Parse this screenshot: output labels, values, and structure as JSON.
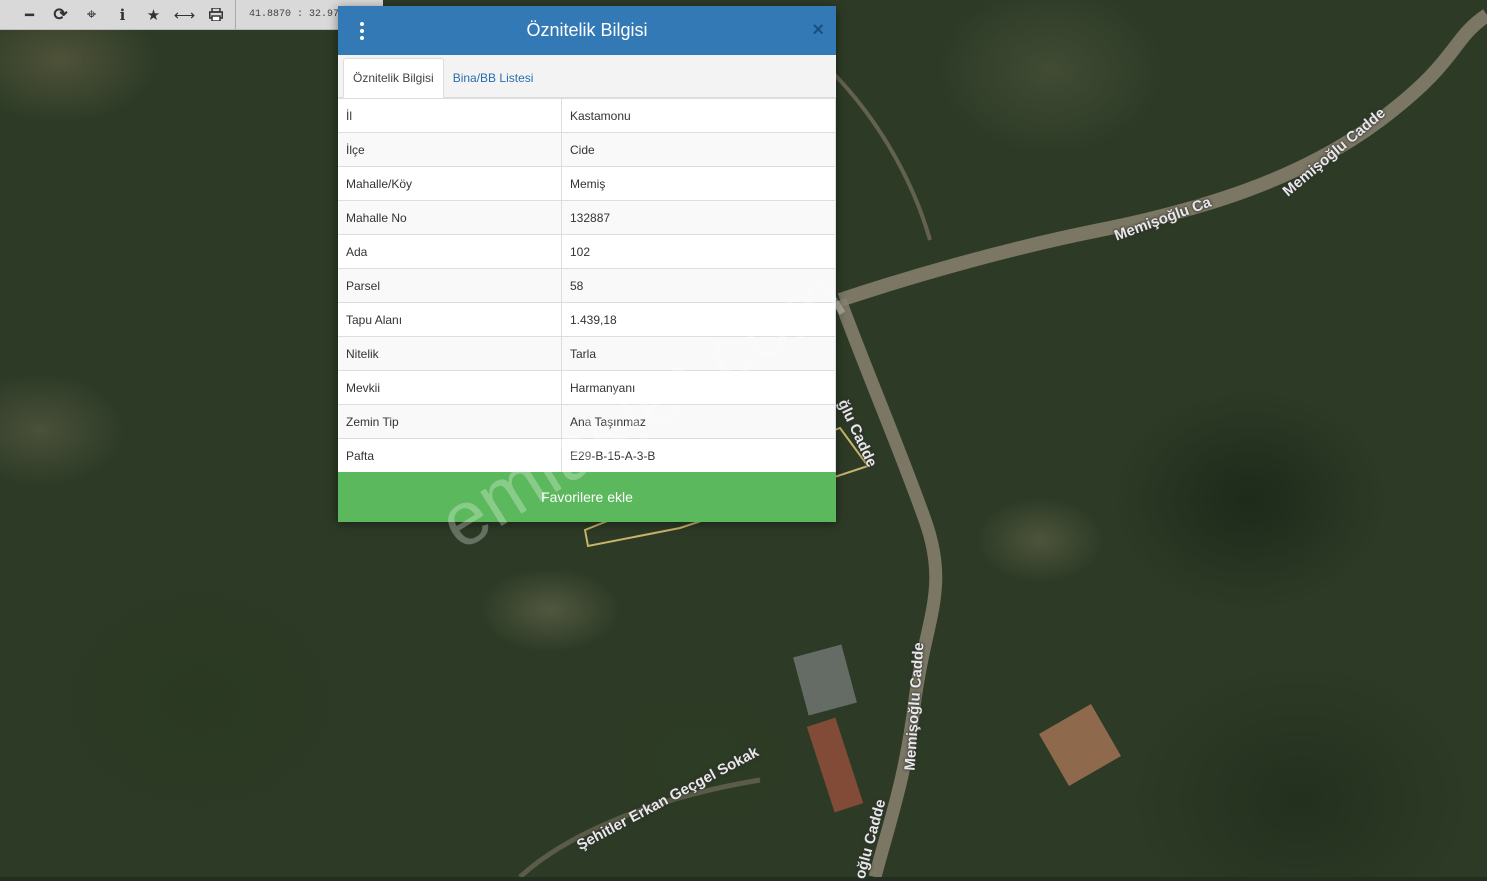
{
  "toolbar": {
    "coords": "41.8870 : 32.9734",
    "buttons": [
      {
        "name": "zoom-out-icon",
        "glyph": "━"
      },
      {
        "name": "refresh-icon",
        "glyph": "⟳"
      },
      {
        "name": "crosshair-icon",
        "glyph": "⌖"
      },
      {
        "name": "info-icon",
        "glyph": "ℹ"
      },
      {
        "name": "star-icon",
        "glyph": "★"
      },
      {
        "name": "measure-icon",
        "glyph": "⟷"
      },
      {
        "name": "print-icon",
        "glyph": "⎙"
      }
    ]
  },
  "dialog": {
    "title": "Öznitelik Bilgisi",
    "close_label": "×",
    "tabs": [
      {
        "label": "Öznitelik Bilgisi",
        "active": true
      },
      {
        "label": "Bina/BB Listesi",
        "active": false
      }
    ],
    "rows": [
      {
        "key": "İl",
        "value": "Kastamonu"
      },
      {
        "key": "İlçe",
        "value": "Cide"
      },
      {
        "key": "Mahalle/Köy",
        "value": "Memiş"
      },
      {
        "key": "Mahalle No",
        "value": "132887"
      },
      {
        "key": "Ada",
        "value": "102"
      },
      {
        "key": "Parsel",
        "value": "58"
      },
      {
        "key": "Tapu Alanı",
        "value": "1.439,18"
      },
      {
        "key": "Nitelik",
        "value": "Tarla"
      },
      {
        "key": "Mevkii",
        "value": "Harmanyanı"
      },
      {
        "key": "Zemin Tip",
        "value": "Ana Taşınmaz"
      },
      {
        "key": "Pafta",
        "value": "E29-B-15-A-3-B"
      }
    ],
    "favorite_button": "Favorilere ekle"
  },
  "map": {
    "road_labels": [
      "Memişoğlu Ca",
      "Memişoğlu Cadde",
      "Memişoğlu Cadde",
      "Şehitler Erkan Geçgel Sokak",
      "oğlu Cadde",
      "ğlu Cadde"
    ]
  },
  "watermark": "emlakjet.com",
  "colors": {
    "header": "#3279b6",
    "favorite": "#5cb85c",
    "tab_link": "#2a6eae"
  }
}
